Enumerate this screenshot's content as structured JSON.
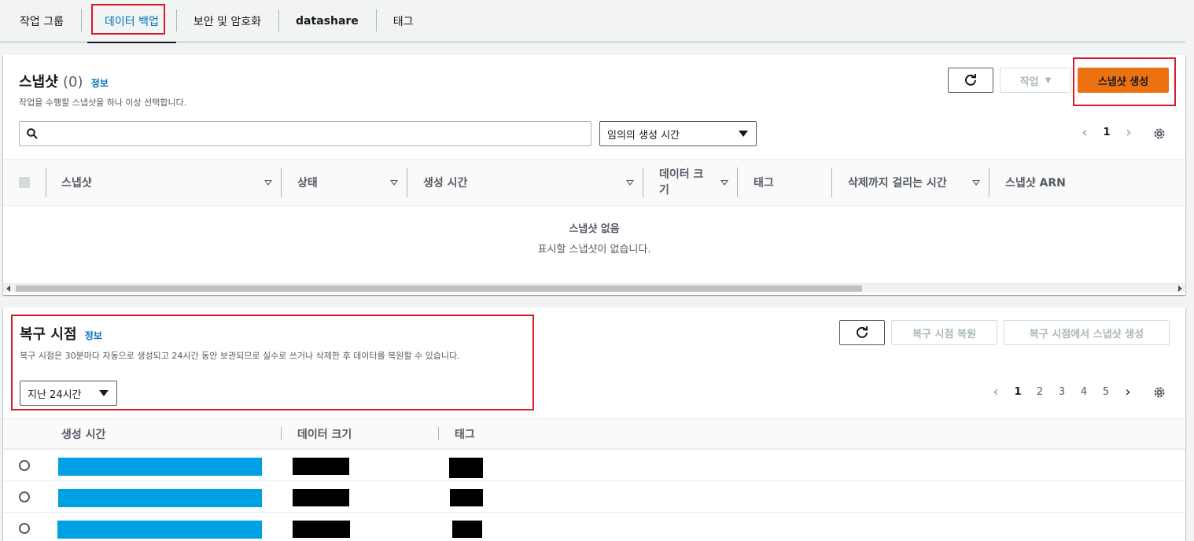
{
  "tabs": [
    {
      "label": "작업 그룹"
    },
    {
      "label": "데이터 백업"
    },
    {
      "label": "보안 및 암호화"
    },
    {
      "label": "datashare"
    },
    {
      "label": "태그"
    }
  ],
  "snapshots": {
    "title": "스냅샷",
    "count": "(0)",
    "info": "정보",
    "description": "작업을 수행할 스냅샷을 하나 이상 선택합니다.",
    "actions_label": "작업",
    "create_label": "스냅샷 생성",
    "search_value": "",
    "filter_select": "임의의 생성 시간",
    "page": "1",
    "columns": [
      "스냅샷",
      "상태",
      "생성 시간",
      "데이터 크기",
      "태그",
      "삭제까지 걸리는 시간",
      "스냅샷 ARN"
    ],
    "empty_title": "스냅샷 없음",
    "empty_desc": "표시할 스냅샷이 없습니다."
  },
  "recovery": {
    "title": "복구 시점",
    "info": "정보",
    "description": "복구 시점은 30분마다 자동으로 생성되고 24시간 동안 보관되므로 실수로 쓰거나 삭제한 후 데이터를 복원할 수 있습니다.",
    "restore_label": "복구 시점 복원",
    "create_snapshot_label": "복구 시점에서 스냅샷 생성",
    "range_select": "지난 24시간",
    "pages": [
      "1",
      "2",
      "3",
      "4",
      "5"
    ],
    "columns": [
      "생성 시간",
      "데이터 크기",
      "태그"
    ],
    "row_count": 3
  },
  "colors": {
    "accent": "#0073bb",
    "primary_button": "#ec7211",
    "highlight": "#d91a2a",
    "redact_blue": "#00a1e4"
  }
}
